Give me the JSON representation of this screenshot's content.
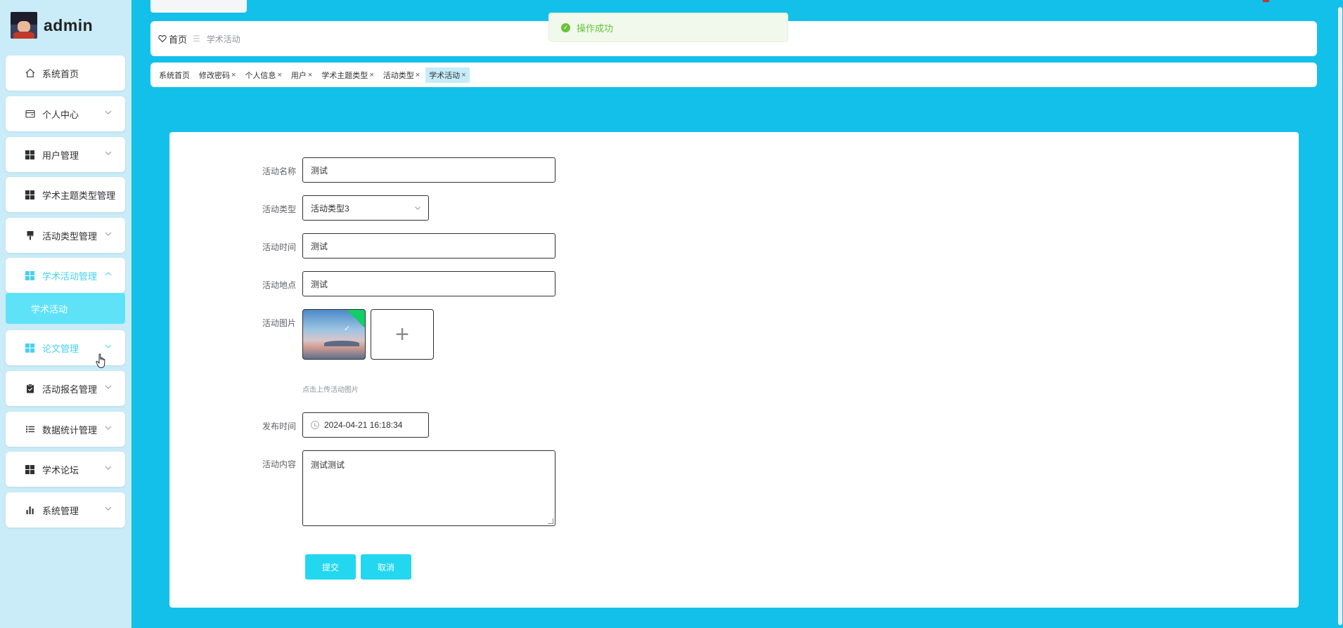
{
  "brand": {
    "name": "admin"
  },
  "sidebar": {
    "items": [
      {
        "label": "系统首页",
        "icon": "home-icon"
      },
      {
        "label": "个人中心",
        "icon": "wallet-icon"
      },
      {
        "label": "用户管理",
        "icon": "grid-icon"
      },
      {
        "label": "学术主题类型管理",
        "icon": "grid-icon"
      },
      {
        "label": "活动类型管理",
        "icon": "brush-icon"
      },
      {
        "label": "学术活动管理",
        "icon": "grid-icon"
      },
      {
        "label": "论文管理",
        "icon": "grid-icon"
      },
      {
        "label": "活动报名管理",
        "icon": "clipboard-icon"
      },
      {
        "label": "数据统计管理",
        "icon": "list-icon"
      },
      {
        "label": "学术论坛",
        "icon": "grid-icon"
      },
      {
        "label": "系统管理",
        "icon": "bar-chart-icon"
      }
    ],
    "submenu": {
      "label": "学术活动"
    }
  },
  "breadcrumb": {
    "home": "首页",
    "separator": "☰",
    "current": "学术活动"
  },
  "toast": {
    "text": "操作成功",
    "color": "#67c23a"
  },
  "tags": [
    {
      "label": "系统首页"
    },
    {
      "label": "修改密码"
    },
    {
      "label": "个人信息"
    },
    {
      "label": "用户"
    },
    {
      "label": "学术主题类型"
    },
    {
      "label": "活动类型"
    },
    {
      "label": "学术活动"
    }
  ],
  "form": {
    "name": {
      "label": "活动名称",
      "value": "测试"
    },
    "type": {
      "label": "活动类型",
      "value": "活动类型3"
    },
    "time": {
      "label": "活动时间",
      "value": "测试"
    },
    "place": {
      "label": "活动地点",
      "value": "测试"
    },
    "image": {
      "label": "活动图片",
      "hint": "点击上传活动图片"
    },
    "publish": {
      "label": "发布时间",
      "value": "2024-04-21 16:18:34"
    },
    "content": {
      "label": "活动内容",
      "value": "测试测试"
    }
  },
  "actions": {
    "submit": "提交",
    "cancel": "取消"
  },
  "colors": {
    "background": "#13c0ea",
    "sidebar": "#c9ecf8",
    "accent": "#22d7ef",
    "active_text": "#48d1ee"
  }
}
